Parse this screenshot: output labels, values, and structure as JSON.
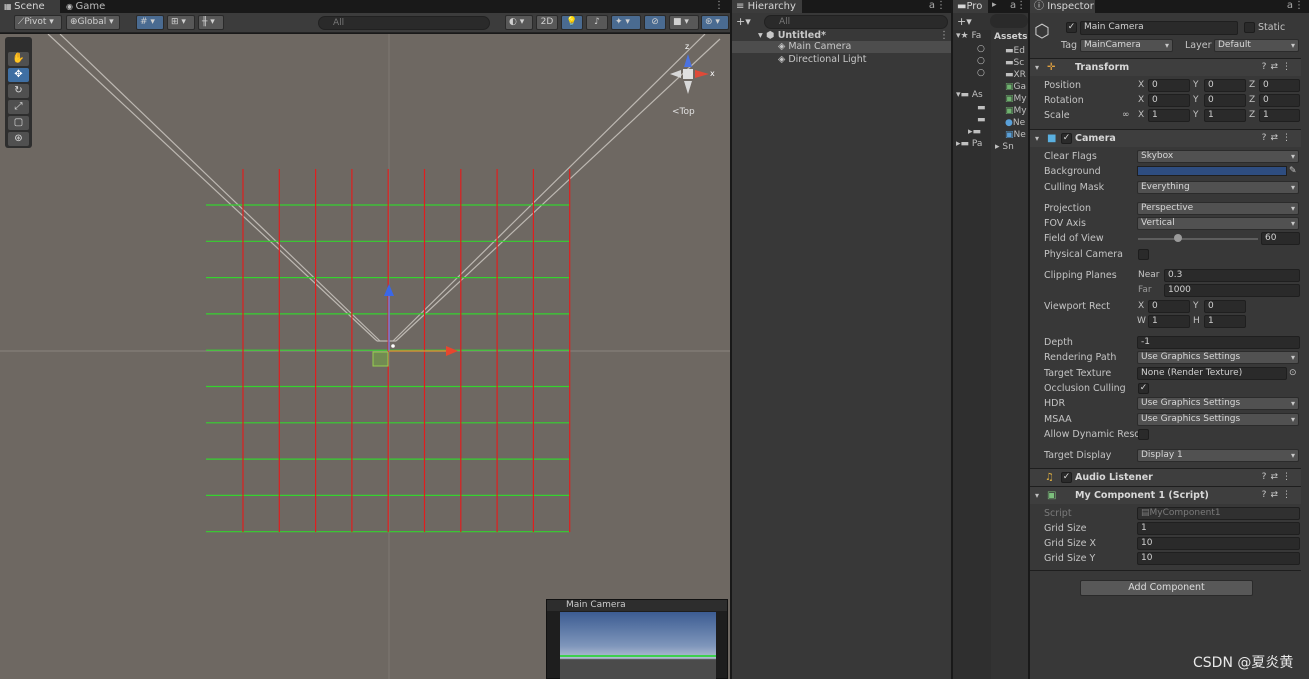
{
  "scene_view": {
    "tabs": [
      "Scene",
      "Game"
    ],
    "toolbar": {
      "pivot": "Pivot",
      "global": "Global",
      "search_placeholder": "All",
      "mode_2d": "2D"
    },
    "gizmo_label": "<Top",
    "camera_preview_title": "Main Camera",
    "grid": {
      "size": 1,
      "size_x": 10,
      "size_y": 10
    }
  },
  "hierarchy": {
    "tab": "Hierarchy",
    "search_placeholder": "All",
    "scene": "Untitled*",
    "items": [
      "Main Camera",
      "Directional Light"
    ]
  },
  "project": {
    "tab": "Pro",
    "favorites_label": "Fa",
    "assets_label": "As",
    "packages_label": "Pa",
    "assets_header": "Assets",
    "files": [
      "Ed",
      "Sc",
      "XR",
      "Ga",
      "My",
      "My",
      "Ne",
      "Ne",
      "Sn"
    ]
  },
  "inspector": {
    "tab": "Inspector",
    "object_name": "Main Camera",
    "static_label": "Static",
    "tag_label": "Tag",
    "tag_value": "MainCamera",
    "layer_label": "Layer",
    "layer_value": "Default",
    "transform": {
      "title": "Transform",
      "position_label": "Position",
      "rotation_label": "Rotation",
      "scale_label": "Scale",
      "position": [
        "0",
        "0",
        "0"
      ],
      "rotation": [
        "0",
        "0",
        "0"
      ],
      "scale": [
        "1",
        "1",
        "1"
      ]
    },
    "camera": {
      "title": "Camera",
      "clear_flags_label": "Clear Flags",
      "clear_flags": "Skybox",
      "background_label": "Background",
      "background_color": "#2e4d80",
      "culling_mask_label": "Culling Mask",
      "culling_mask": "Everything",
      "projection_label": "Projection",
      "projection": "Perspective",
      "fov_axis_label": "FOV Axis",
      "fov_axis": "Vertical",
      "fov_label": "Field of View",
      "fov": "60",
      "fov_slider_fraction": 0.33,
      "physical_label": "Physical Camera",
      "clipping_label": "Clipping Planes",
      "near_label": "Near",
      "near": "0.3",
      "far_label": "Far",
      "far": "1000",
      "viewport_label": "Viewport Rect",
      "vp_x": "0",
      "vp_y": "0",
      "vp_w": "1",
      "vp_h": "1",
      "depth_label": "Depth",
      "depth": "-1",
      "rendering_path_label": "Rendering Path",
      "rendering_path": "Use Graphics Settings",
      "target_texture_label": "Target Texture",
      "target_texture": "None (Render Texture)",
      "occlusion_label": "Occlusion Culling",
      "hdr_label": "HDR",
      "hdr": "Use Graphics Settings",
      "msaa_label": "MSAA",
      "msaa": "Use Graphics Settings",
      "dynamic_res_label": "Allow Dynamic Reso",
      "target_display_label": "Target Display",
      "target_display": "Display 1"
    },
    "audio_listener": {
      "title": "Audio Listener"
    },
    "my_component": {
      "title": "My Component 1 (Script)",
      "script_label": "Script",
      "script_value": "MyComponent1",
      "grid_size_label": "Grid Size",
      "grid_size": "1",
      "grid_size_x_label": "Grid Size X",
      "grid_size_x": "10",
      "grid_size_y_label": "Grid Size Y",
      "grid_size_y": "10"
    },
    "add_component": "Add Component"
  },
  "watermark": "CSDN @夏炎黄"
}
